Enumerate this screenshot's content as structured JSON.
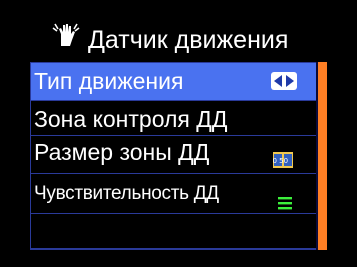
{
  "header": {
    "title": "Датчик движения",
    "icon": "hand-wave-icon"
  },
  "menu": {
    "items": [
      {
        "label": "Тип движения",
        "icon": "left-right-arrows-icon",
        "selected": true
      },
      {
        "label": "Зона контроля ДД",
        "icon": "",
        "selected": false
      },
      {
        "label": "Размер зоны ДД",
        "icon": "zone-size-icon",
        "icon_text": "50 50",
        "selected": false
      },
      {
        "label": "Чувствительность ДД",
        "icon": "sensitivity-bars-icon",
        "selected": false
      },
      {
        "label": "",
        "icon": "",
        "selected": false
      }
    ]
  },
  "colors": {
    "background": "#000000",
    "selection": "#4a72f0",
    "row_border": "#2a3a9a",
    "scrollbar": "#ff7f24",
    "sensitivity": "#3cf03c"
  }
}
